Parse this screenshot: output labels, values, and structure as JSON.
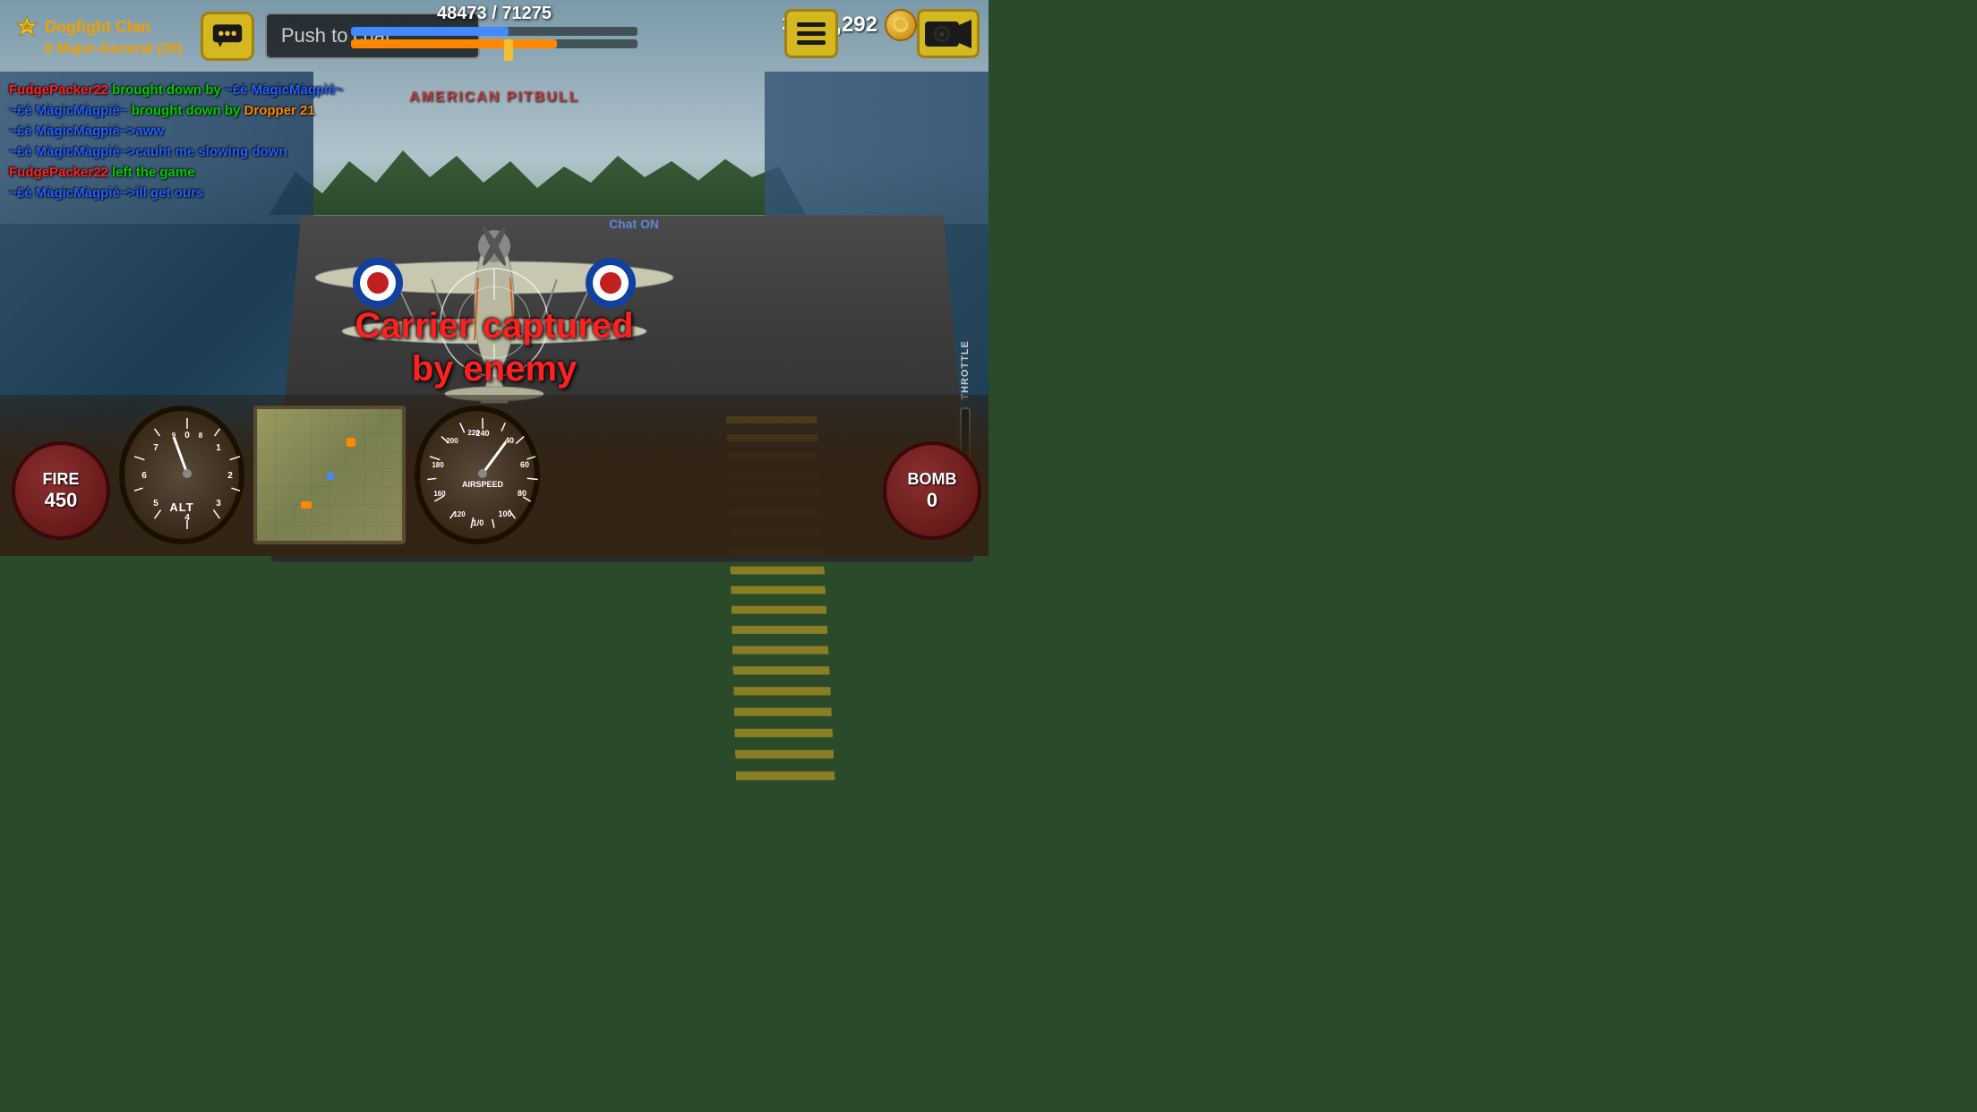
{
  "game": {
    "title": "Dogfight",
    "score": "48473 / 71275",
    "player": {
      "clan": "Dogfight Clan",
      "rank": "II Major-General (20)"
    },
    "coins": "3,500,292",
    "aircraft_name": "AMERICAN PITBULL",
    "push_to_chat_placeholder": "Push to chat",
    "chat_on_label": "Chat ON",
    "carrier_message_line1": "Carrier captured",
    "carrier_message_line2": "by enemy"
  },
  "chat_messages": [
    {
      "text": "FudgePacker22 brought down by ~£é MàgicMàgpié~",
      "color_parts": [
        {
          "text": "FudgePacker22",
          "color": "#ff2020"
        },
        {
          "text": " brought down by ",
          "color": "#00cc00"
        },
        {
          "text": "~£é MàgicMàgpié~",
          "color": "#2060ff"
        }
      ]
    },
    {
      "text": "~£é MàgicMàgpié~ brought down by Dropper 21",
      "color_parts": [
        {
          "text": "~£é MàgicMàgpié~",
          "color": "#2060ff"
        },
        {
          "text": " brought down by ",
          "color": "#00cc00"
        },
        {
          "text": "Dropper 21",
          "color": "#ff8800"
        }
      ]
    },
    {
      "text": "~£é MàgicMàgpié~>aww",
      "color_parts": [
        {
          "text": "~£é MàgicMàgpié~>",
          "color": "#2060ff"
        },
        {
          "text": "aww",
          "color": "#2060ff"
        }
      ]
    },
    {
      "text": "~£é MàgicMàgpié~>cauht me slowing down",
      "color_parts": [
        {
          "text": "~£é MàgicMàgpié~>",
          "color": "#2060ff"
        },
        {
          "text": "cauht me slowing down",
          "color": "#2060ff"
        }
      ]
    },
    {
      "text": "FudgePacker22 left the game",
      "color_parts": [
        {
          "text": "FudgePacker22",
          "color": "#ff2020"
        },
        {
          "text": " left the game",
          "color": "#00cc00"
        }
      ]
    },
    {
      "text": "~£é MàgicMàgpié~>ill get ours",
      "color_parts": [
        {
          "text": "~£é MàgicMàgpié~>",
          "color": "#2060ff"
        },
        {
          "text": "ill get ours",
          "color": "#2060ff"
        }
      ]
    }
  ],
  "hud": {
    "fire_label": "FIRE",
    "fire_count": "450",
    "bomb_label": "BOMB",
    "bomb_count": "0",
    "alt_label": "ALT",
    "airspeed_label": "AIRSPEED",
    "throttle_label": "THROTTLE",
    "menu_btn_label": "Menu",
    "camera_btn_label": "Camera"
  },
  "icons": {
    "chat_icon": "💬",
    "coin_icon": "🪙",
    "star_icon": "⭐",
    "menu_icon": "☰",
    "camera_icon": "🎥"
  },
  "airspeed_ticks": [
    "240",
    "220",
    "200",
    "180",
    "160",
    "40",
    "60",
    "80",
    "100",
    "120"
  ],
  "alt_ticks": [
    "0",
    "1",
    "2",
    "3",
    "4",
    "5",
    "6",
    "7",
    "8",
    "9"
  ]
}
